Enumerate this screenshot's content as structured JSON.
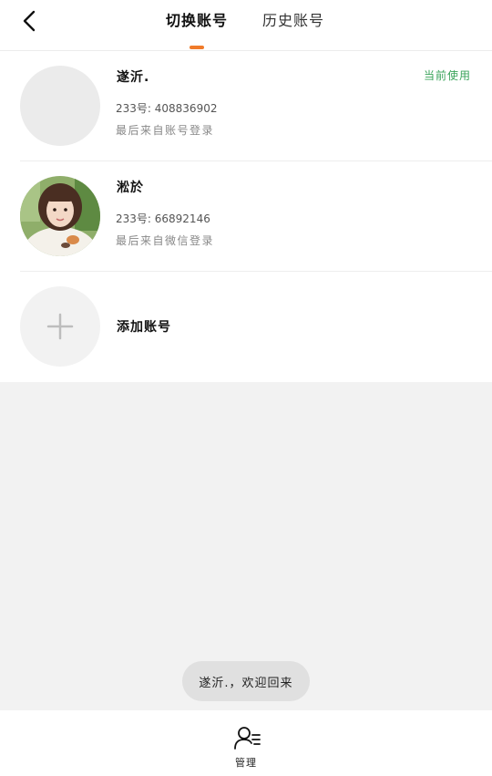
{
  "header": {
    "tabs": [
      {
        "label": "切换账号",
        "active": true
      },
      {
        "label": "历史账号",
        "active": false
      }
    ],
    "accent_color": "#f07b2a"
  },
  "accounts": [
    {
      "name": "遂沂.",
      "id_text": "233号: 408836902",
      "source_text": "最后来自账号登录",
      "status": "当前使用",
      "status_color": "#3aa35a"
    },
    {
      "name": "淞於",
      "id_text": "233号: 66892146",
      "source_text": "最后来自微信登录"
    }
  ],
  "add_account": {
    "label": "添加账号",
    "icon": "plus-icon"
  },
  "toast": {
    "text": "遂沂.，欢迎回来"
  },
  "bottom_nav": {
    "manage_label": "管理",
    "manage_icon": "user-list-icon"
  }
}
